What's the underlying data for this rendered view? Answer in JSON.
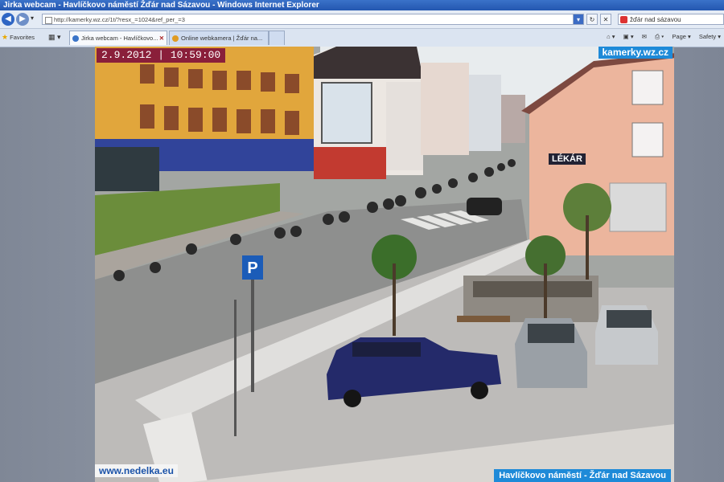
{
  "window": {
    "title": "Jirka webcam - Havlíčkovo náměstí Žďár nad Sázavou - Windows Internet Explorer"
  },
  "address_bar": {
    "url": "http://kamerky.wz.cz/1t/?resx_=1024&ref_per_=3"
  },
  "search": {
    "value": "žďár nad sázavou"
  },
  "favorites": {
    "label": "Favorites"
  },
  "tabs": [
    {
      "label": "Jirka webcam - Havlíčkovo...",
      "active": true
    },
    {
      "label": "Online webkamera | Žďár na...",
      "active": false
    }
  ],
  "toolbar": {
    "page_label": "Page ▾",
    "safety_label": "Safety ▾"
  },
  "webcam": {
    "timestamp": "2.9.2012 | 10:59:00",
    "site_label": "kamerky.wz.cz",
    "footer_left": "www.nedelka.eu",
    "footer_right": "Havlíčkovo náměstí - Žďár nad Sázavou",
    "sign_text": "LÉKÁR"
  },
  "colors": {
    "titlebar": "#2457b0",
    "overlay_blue": "#1e8ad8",
    "overlay_red": "#8a1f3a"
  },
  "icons": [
    "back-icon",
    "forward-icon",
    "dropdown-icon",
    "compatibility-icon",
    "refresh-icon",
    "stop-icon",
    "search-engine-icon",
    "favorites-star-icon",
    "quick-tabs-icon",
    "home-icon",
    "feeds-icon",
    "mail-icon",
    "print-icon"
  ]
}
